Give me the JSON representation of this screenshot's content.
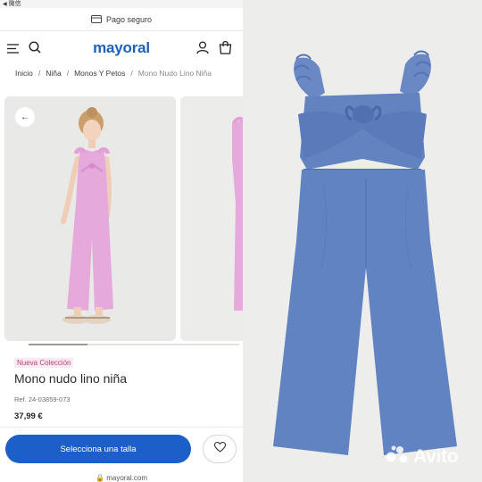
{
  "statusbar": {
    "back_label": "微信"
  },
  "paybar": {
    "label": "Pago seguro",
    "icon": "card-icon"
  },
  "header": {
    "logo": "mayoral",
    "icons": [
      "menu-icon",
      "search-icon",
      "user-icon",
      "bag-icon"
    ]
  },
  "breadcrumbs": [
    "Inicio",
    "Niña",
    "Monos Y Petos",
    "Mono Nudo Lino Niña"
  ],
  "gallery": {
    "back_icon": "arrow-left-icon"
  },
  "product": {
    "badge": "Nueva Colección",
    "title": "Mono nudo lino niña",
    "ref": "Ref. 24-03859-073",
    "price": "37,99 €"
  },
  "cta": {
    "size_button": "Selecciona una talla",
    "fav_icon": "heart-icon"
  },
  "footer": {
    "domain": "mayoral.com"
  },
  "watermark": {
    "text": "Avito"
  },
  "colors": {
    "accent": "#1d5fc9",
    "logo": "#1d62b8",
    "badge_text": "#b0447a",
    "badge_bg": "#fbe9f2",
    "jumpsuit_pink": "#e6a9dc",
    "jumpsuit_blue": "#5d7dbb"
  }
}
